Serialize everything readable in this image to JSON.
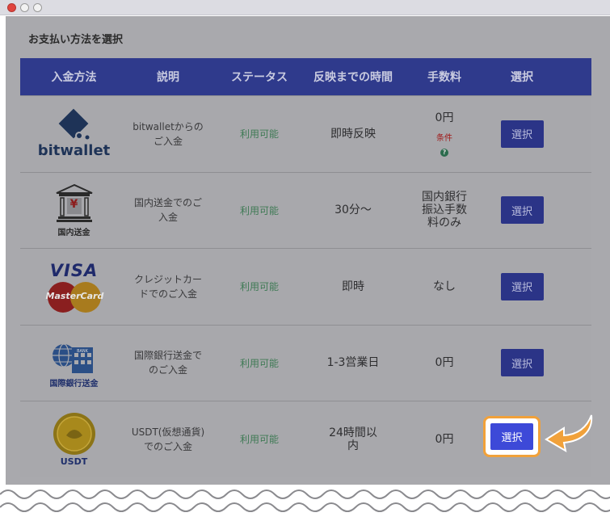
{
  "heading": "お支払い方法を選択",
  "columns": [
    "入金方法",
    "説明",
    "ステータス",
    "反映までの時間",
    "手数料",
    "選択"
  ],
  "rows": [
    {
      "method_label": "bitwallet",
      "desc_line1": "bitwalletからの",
      "desc_line2": "ご入金",
      "status": "利用可能",
      "time_line1": "即時反映",
      "time_line2": "",
      "fee_line1": "0円",
      "fee_line2": "",
      "fee_line3": "",
      "fee_condition": "条件",
      "fee_help": "?",
      "select": "選択"
    },
    {
      "method_label": "国内送金",
      "method_glyph": "¥",
      "desc_line1": "国内送金でのご",
      "desc_line2": "入金",
      "status": "利用可能",
      "time_line1": "30分〜",
      "time_line2": "",
      "fee_line1": "国内銀行",
      "fee_line2": "振込手数",
      "fee_line3": "料のみ",
      "select": "選択"
    },
    {
      "method_label_visa": "VISA",
      "method_label_mc": "MasterCard",
      "desc_line1": "クレジットカー",
      "desc_line2": "ドでのご入金",
      "status": "利用可能",
      "time_line1": "即時",
      "time_line2": "",
      "fee_line1": "なし",
      "fee_line2": "",
      "fee_line3": "",
      "select": "選択"
    },
    {
      "method_label": "国際銀行送金",
      "method_glyph": "BANK",
      "desc_line1": "国際銀行送金で",
      "desc_line2": "のご入金",
      "status": "利用可能",
      "time_line1": "1-3営業日",
      "time_line2": "",
      "fee_line1": "0円",
      "fee_line2": "",
      "fee_line3": "",
      "select": "選択"
    },
    {
      "method_label": "USDT",
      "desc_line1": "USDT(仮想通貨)",
      "desc_line2": "でのご入金",
      "status": "利用可能",
      "time_line1": "24時間以",
      "time_line2": "内",
      "fee_line1": "0円",
      "fee_line2": "",
      "fee_line3": "",
      "select": "選択"
    }
  ],
  "colors": {
    "header_bg": "#2f3a8c",
    "button": "#2b3487",
    "highlight_button": "#3d49d8",
    "highlight_border": "#f1a13a",
    "status_text": "#3f7a55"
  }
}
